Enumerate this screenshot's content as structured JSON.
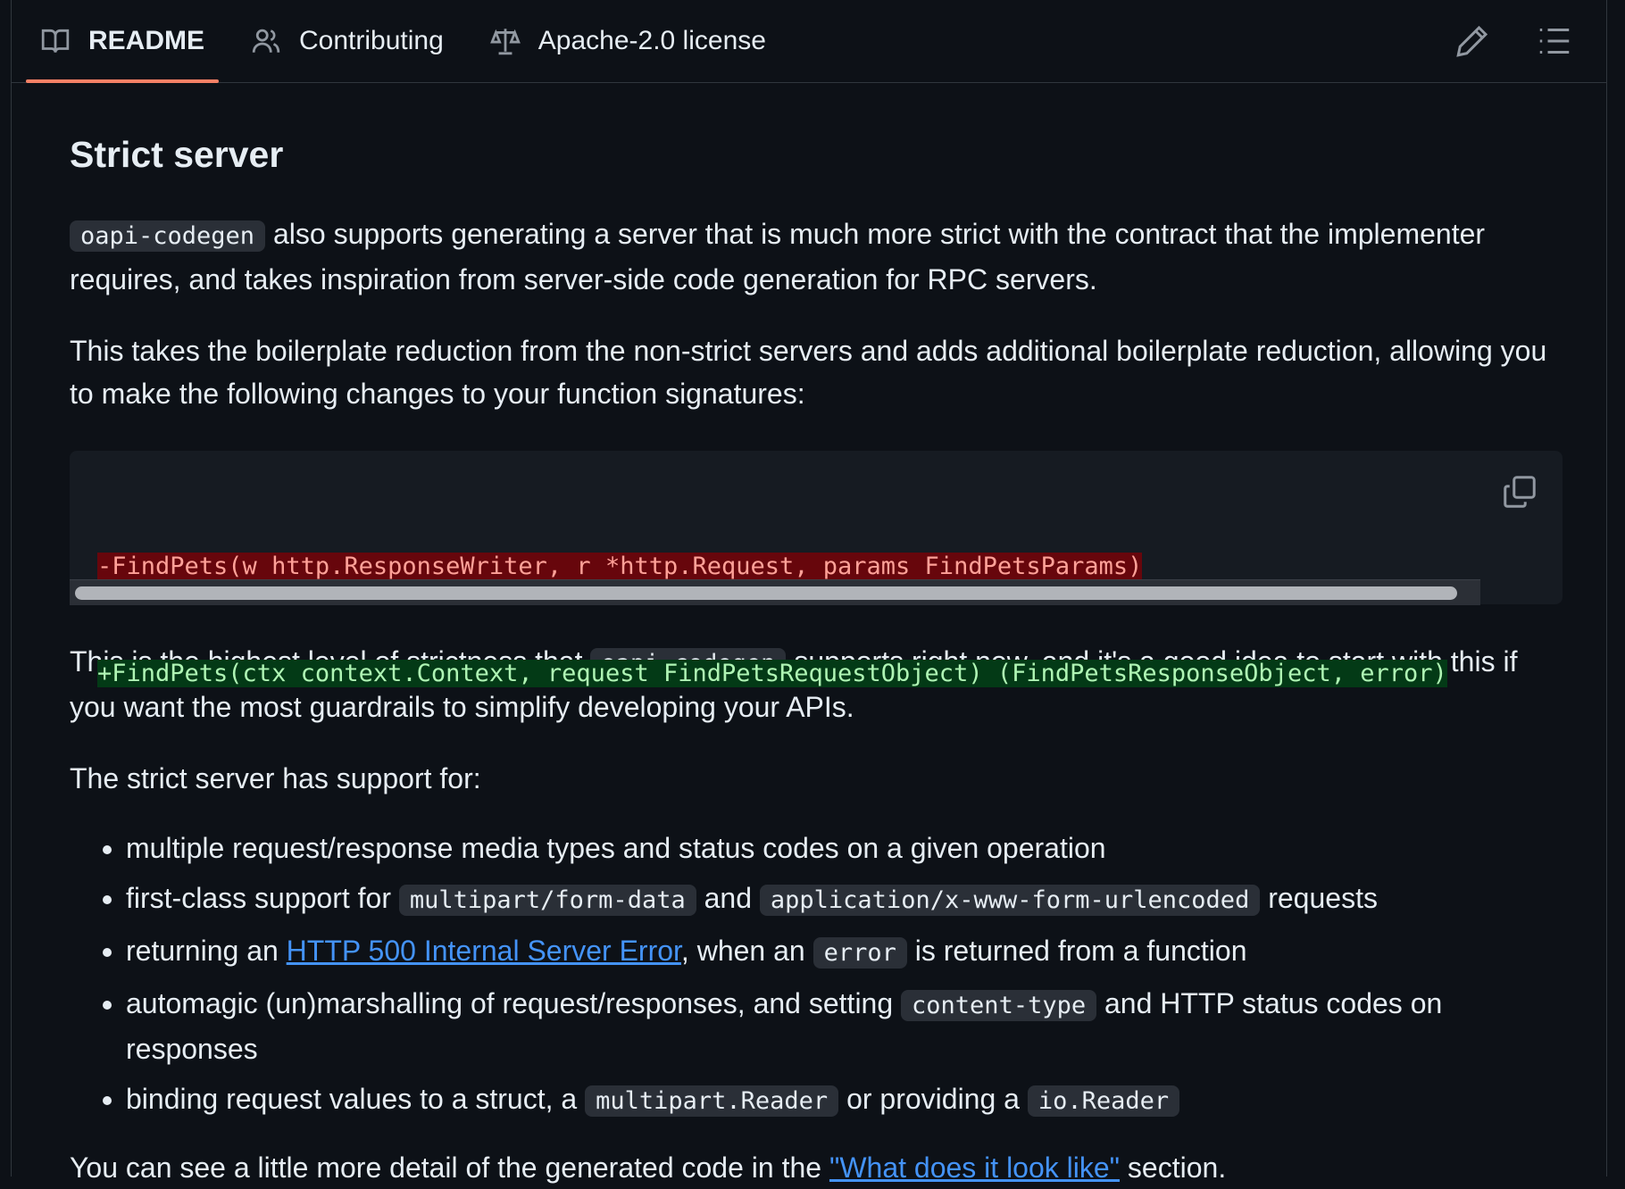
{
  "tabs": [
    {
      "label": "README",
      "icon": "book-icon",
      "active": true
    },
    {
      "label": "Contributing",
      "icon": "people-icon",
      "active": false
    },
    {
      "label": "Apache-2.0 license",
      "icon": "law-icon",
      "active": false
    }
  ],
  "toolbar": {
    "edit_icon": "pencil-icon",
    "outline_icon": "list-icon"
  },
  "readme": {
    "heading": "Strict server",
    "p1": {
      "code": "oapi-codegen",
      "text": " also supports generating a server that is much more strict with the contract that the implementer requires, and takes inspiration from server-side code generation for RPC servers."
    },
    "p2": "This takes the boilerplate reduction from the non-strict servers and adds additional boilerplate reduction, allowing you to make the following changes to your function signatures:",
    "code_block": {
      "removed": "-FindPets(w http.ResponseWriter, r *http.Request, params FindPetsParams)",
      "added": "+FindPets(ctx context.Context, request FindPetsRequestObject) (FindPetsResponseObject, error)"
    },
    "p3": {
      "before": "This is the highest level of strictness that ",
      "code": "oapi-codegen",
      "after": " supports right now, and it's a good idea to start with this if you want the most guardrails to simplify developing your APIs."
    },
    "p4": "The strict server has support for:",
    "list": {
      "item1": "multiple request/response media types and status codes on a given operation",
      "item2": {
        "before": "first-class support for ",
        "code1": "multipart/form-data",
        "mid": " and ",
        "code2": "application/x-www-form-urlencoded",
        "after": " requests"
      },
      "item3": {
        "before": "returning an ",
        "link": "HTTP 500 Internal Server Error",
        "mid": ", when an ",
        "code": "error",
        "after": " is returned from a function"
      },
      "item4": {
        "before": "automagic (un)marshalling of request/responses, and setting ",
        "code": "content-type",
        "after": " and HTTP status codes on responses"
      },
      "item5": {
        "before": "binding request values to a struct, a ",
        "code1": "multipart.Reader",
        "mid": " or providing a ",
        "code2": "io.Reader"
      }
    },
    "p5": {
      "before": "You can see a little more detail of the generated code in the ",
      "link": "\"What does it look like\"",
      "after": " section."
    }
  },
  "colors": {
    "background": "#0d1117",
    "tab_underline": "#f78166",
    "link": "#4493f8",
    "diff_removed_bg": "#67060c",
    "diff_added_bg": "#033a16"
  }
}
